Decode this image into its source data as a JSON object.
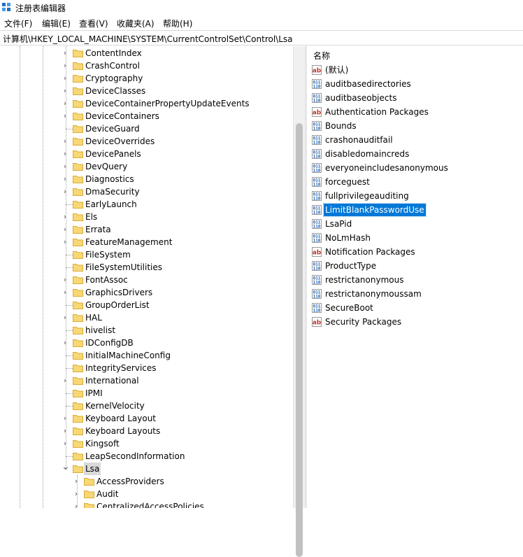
{
  "window": {
    "title": "注册表编辑器"
  },
  "menu": [
    "文件(F)",
    "编辑(E)",
    "查看(V)",
    "收藏夹(A)",
    "帮助(H)"
  ],
  "address": "计算机\\HKEY_LOCAL_MACHINE\\SYSTEM\\CurrentControlSet\\Control\\Lsa",
  "tree": [
    {
      "label": "ContentIndex",
      "expander": "collapsed",
      "level": 0
    },
    {
      "label": "CrashControl",
      "expander": "collapsed",
      "level": 0
    },
    {
      "label": "Cryptography",
      "expander": "collapsed",
      "level": 0
    },
    {
      "label": "DeviceClasses",
      "expander": "collapsed",
      "level": 0
    },
    {
      "label": "DeviceContainerPropertyUpdateEvents",
      "expander": "collapsed",
      "level": 0
    },
    {
      "label": "DeviceContainers",
      "expander": "collapsed",
      "level": 0
    },
    {
      "label": "DeviceGuard",
      "expander": "none",
      "level": 0
    },
    {
      "label": "DeviceOverrides",
      "expander": "collapsed",
      "level": 0
    },
    {
      "label": "DevicePanels",
      "expander": "collapsed",
      "level": 0
    },
    {
      "label": "DevQuery",
      "expander": "collapsed",
      "level": 0
    },
    {
      "label": "Diagnostics",
      "expander": "collapsed",
      "level": 0
    },
    {
      "label": "DmaSecurity",
      "expander": "collapsed",
      "level": 0
    },
    {
      "label": "EarlyLaunch",
      "expander": "none",
      "level": 0
    },
    {
      "label": "Els",
      "expander": "collapsed",
      "level": 0
    },
    {
      "label": "Errata",
      "expander": "collapsed",
      "level": 0
    },
    {
      "label": "FeatureManagement",
      "expander": "collapsed",
      "level": 0
    },
    {
      "label": "FileSystem",
      "expander": "none",
      "level": 0
    },
    {
      "label": "FileSystemUtilities",
      "expander": "none",
      "level": 0
    },
    {
      "label": "FontAssoc",
      "expander": "collapsed",
      "level": 0
    },
    {
      "label": "GraphicsDrivers",
      "expander": "collapsed",
      "level": 0
    },
    {
      "label": "GroupOrderList",
      "expander": "none",
      "level": 0
    },
    {
      "label": "HAL",
      "expander": "collapsed",
      "level": 0
    },
    {
      "label": "hivelist",
      "expander": "none",
      "level": 0
    },
    {
      "label": "IDConfigDB",
      "expander": "collapsed",
      "level": 0
    },
    {
      "label": "InitialMachineConfig",
      "expander": "none",
      "level": 0
    },
    {
      "label": "IntegrityServices",
      "expander": "none",
      "level": 0
    },
    {
      "label": "International",
      "expander": "collapsed",
      "level": 0
    },
    {
      "label": "IPMI",
      "expander": "none",
      "level": 0
    },
    {
      "label": "KernelVelocity",
      "expander": "none",
      "level": 0
    },
    {
      "label": "Keyboard Layout",
      "expander": "collapsed",
      "level": 0
    },
    {
      "label": "Keyboard Layouts",
      "expander": "collapsed",
      "level": 0
    },
    {
      "label": "Kingsoft",
      "expander": "collapsed",
      "level": 0
    },
    {
      "label": "LeapSecondInformation",
      "expander": "none",
      "level": 0
    },
    {
      "label": "Lsa",
      "expander": "expanded",
      "level": 0,
      "selected": true
    },
    {
      "label": "AccessProviders",
      "expander": "collapsed",
      "level": 1
    },
    {
      "label": "Audit",
      "expander": "collapsed",
      "level": 1
    },
    {
      "label": "CentralizedAccessPolicies",
      "expander": "collapsed",
      "level": 1
    }
  ],
  "list": {
    "header": "名称",
    "values": [
      {
        "name": "(默认)",
        "type": "string"
      },
      {
        "name": "auditbasedirectories",
        "type": "binary"
      },
      {
        "name": "auditbaseobjects",
        "type": "binary"
      },
      {
        "name": "Authentication Packages",
        "type": "string"
      },
      {
        "name": "Bounds",
        "type": "binary"
      },
      {
        "name": "crashonauditfail",
        "type": "binary"
      },
      {
        "name": "disabledomaincreds",
        "type": "binary"
      },
      {
        "name": "everyoneincludesanonymous",
        "type": "binary"
      },
      {
        "name": "forceguest",
        "type": "binary"
      },
      {
        "name": "fullprivilegeauditing",
        "type": "binary"
      },
      {
        "name": "LimitBlankPasswordUse",
        "type": "binary",
        "selected": true
      },
      {
        "name": "LsaPid",
        "type": "binary"
      },
      {
        "name": "NoLmHash",
        "type": "binary"
      },
      {
        "name": "Notification Packages",
        "type": "string"
      },
      {
        "name": "ProductType",
        "type": "binary"
      },
      {
        "name": "restrictanonymous",
        "type": "binary"
      },
      {
        "name": "restrictanonymoussam",
        "type": "binary"
      },
      {
        "name": "SecureBoot",
        "type": "binary"
      },
      {
        "name": "Security Packages",
        "type": "string"
      }
    ]
  },
  "colors": {
    "selection": "#0078d7",
    "tree_selection": "#d9d9d9",
    "folder_yellow": "#f8d775",
    "string_icon_red": "#c0392b",
    "binary_icon_blue": "#1f5fa8"
  }
}
